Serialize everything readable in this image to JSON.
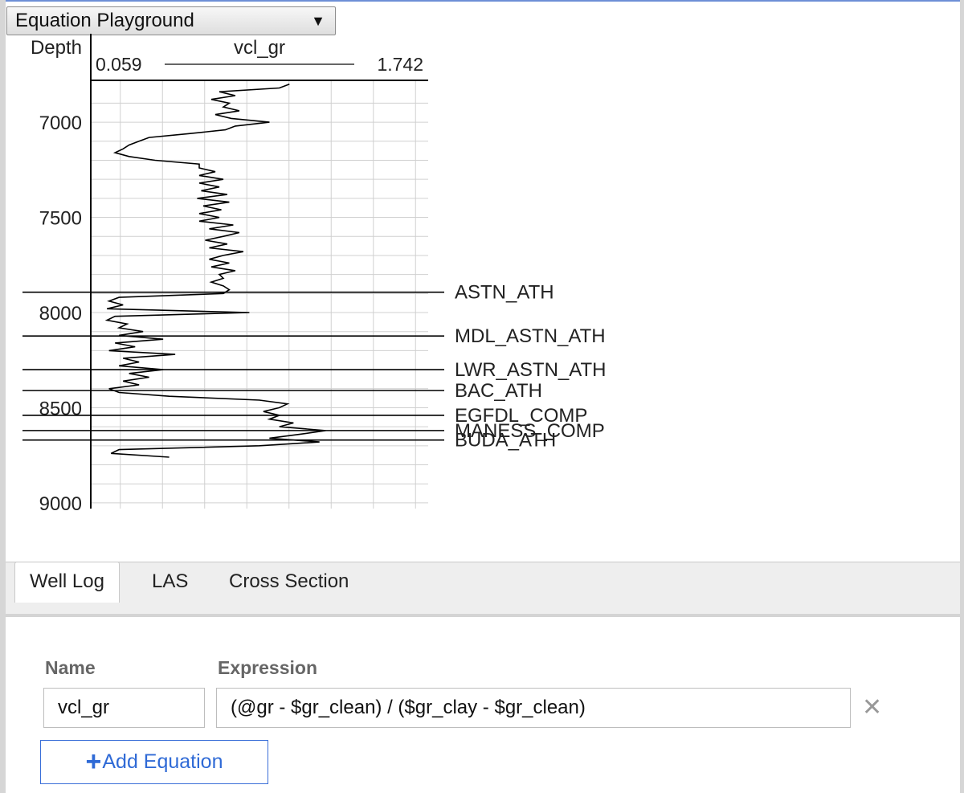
{
  "view_selector": {
    "value": "Equation Playground",
    "arrow_icon": "triangle-down"
  },
  "chart_data": {
    "type": "line",
    "depth_label": "Depth",
    "curve_name": "vcl_gr",
    "scale_min_label": "0.059",
    "scale_max_label": "1.742",
    "x_range": [
      0.059,
      1.742
    ],
    "y_range": [
      6780,
      9030
    ],
    "y_ticks": [
      7000,
      7500,
      8000,
      8500,
      9000
    ],
    "grid": true,
    "series": [
      {
        "name": "vcl_gr",
        "depth": [
          6800,
          6820,
          6840,
          6860,
          6880,
          6900,
          6920,
          6940,
          6960,
          6980,
          7000,
          7020,
          7040,
          7060,
          7080,
          7100,
          7120,
          7140,
          7160,
          7180,
          7200,
          7220,
          7240,
          7260,
          7280,
          7300,
          7320,
          7340,
          7360,
          7380,
          7400,
          7420,
          7440,
          7460,
          7480,
          7500,
          7520,
          7540,
          7560,
          7580,
          7600,
          7620,
          7640,
          7660,
          7680,
          7700,
          7720,
          7740,
          7760,
          7780,
          7800,
          7820,
          7840,
          7860,
          7880,
          7900,
          7920,
          7940,
          7960,
          7980,
          8000,
          8020,
          8040,
          8060,
          8080,
          8100,
          8120,
          8140,
          8160,
          8180,
          8200,
          8220,
          8240,
          8260,
          8280,
          8300,
          8320,
          8340,
          8360,
          8380,
          8400,
          8420,
          8440,
          8460,
          8480,
          8500,
          8520,
          8540,
          8560,
          8580,
          8600,
          8620,
          8640,
          8660,
          8680,
          8700,
          8720,
          8740,
          8760
        ],
        "value": [
          1.05,
          1.0,
          0.7,
          0.78,
          0.66,
          0.75,
          0.72,
          0.8,
          0.68,
          0.76,
          0.95,
          0.78,
          0.73,
          0.55,
          0.35,
          0.3,
          0.25,
          0.22,
          0.18,
          0.25,
          0.38,
          0.6,
          0.6,
          0.68,
          0.6,
          0.72,
          0.6,
          0.7,
          0.61,
          0.74,
          0.59,
          0.75,
          0.62,
          0.71,
          0.6,
          0.7,
          0.6,
          0.77,
          0.65,
          0.8,
          0.72,
          0.63,
          0.74,
          0.65,
          0.82,
          0.72,
          0.65,
          0.75,
          0.66,
          0.78,
          0.7,
          0.72,
          0.66,
          0.72,
          0.75,
          0.72,
          0.2,
          0.15,
          0.22,
          0.14,
          0.85,
          0.18,
          0.14,
          0.24,
          0.2,
          0.32,
          0.2,
          0.42,
          0.18,
          0.28,
          0.15,
          0.48,
          0.22,
          0.3,
          0.2,
          0.42,
          0.25,
          0.35,
          0.22,
          0.3,
          0.15,
          0.2,
          0.45,
          0.9,
          1.04,
          1.0,
          0.92,
          1.0,
          0.95,
          1.07,
          1.0,
          1.23,
          1.1,
          0.95,
          1.2,
          0.9,
          0.2,
          0.16,
          0.45
        ]
      }
    ],
    "tops": [
      {
        "name": "ASTN_ATH",
        "depth": 7893
      },
      {
        "name": "MDL_ASTN_ATH",
        "depth": 8123
      },
      {
        "name": "LWR_ASTN_ATH",
        "depth": 8300
      },
      {
        "name": "BAC_ATH",
        "depth": 8410
      },
      {
        "name": "EGFDL_COMP",
        "depth": 8540
      },
      {
        "name": "MANESS_COMP",
        "depth": 8620
      },
      {
        "name": "BUDA_ATH",
        "depth": 8670
      }
    ]
  },
  "tabs": [
    {
      "label": "Well Log",
      "active": true
    },
    {
      "label": "LAS",
      "active": false
    },
    {
      "label": "Cross Section",
      "active": false
    }
  ],
  "equation_form": {
    "name_label": "Name",
    "expression_label": "Expression",
    "rows": [
      {
        "name": "vcl_gr",
        "expression": "(@gr - $gr_clean) / ($gr_clay - $gr_clean)",
        "remove_icon": "close-icon"
      }
    ],
    "add_button_label": "Add Equation",
    "add_icon": "plus-icon"
  },
  "colors": {
    "accent": "#2f6ad6",
    "curve": "#000000",
    "grid": "#d0d0d0"
  }
}
